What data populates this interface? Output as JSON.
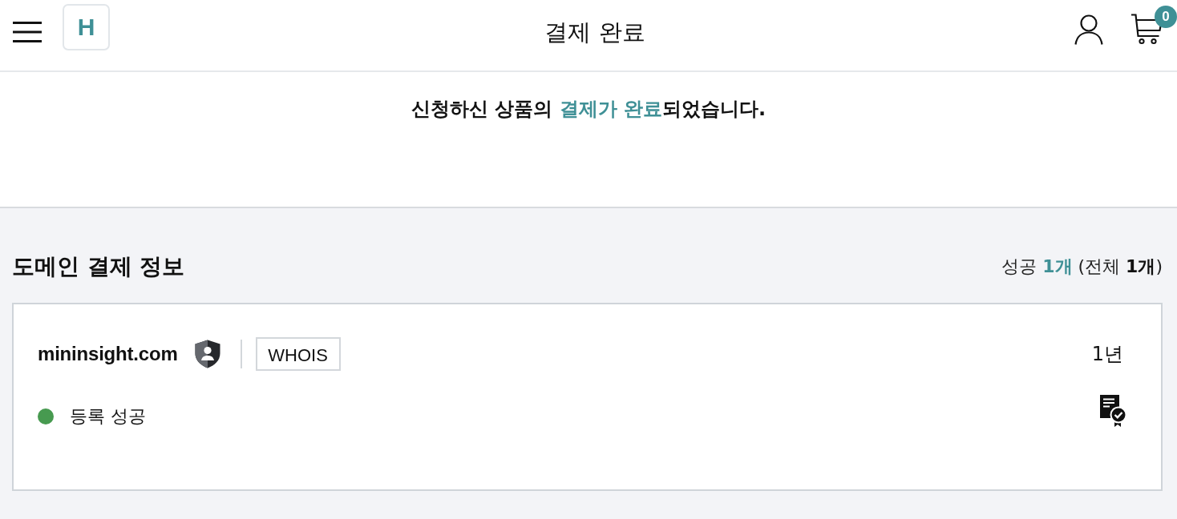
{
  "header": {
    "logo": "H",
    "title": "결제 완료",
    "cart_count": "0"
  },
  "notice": {
    "parts": [
      {
        "text": "신청하신 상품의 ",
        "highlight": false
      },
      {
        "text": "결제가 완료",
        "highlight": true
      },
      {
        "text": "되었습니다.",
        "highlight": false
      }
    ]
  },
  "section": {
    "title": "도메인 결제 정보",
    "summary": [
      {
        "text": "성공 ",
        "kind": "plain"
      },
      {
        "text": "1개",
        "kind": "accent"
      },
      {
        "text": " (전체 ",
        "kind": "plain"
      },
      {
        "text": "1개",
        "kind": "bold"
      },
      {
        "text": ")",
        "kind": "plain"
      }
    ]
  },
  "domains": [
    {
      "name": "mininsight.com",
      "privacy_protected": true,
      "whois_button": "WHOIS",
      "period": "1년",
      "status": {
        "label": "등록 성공",
        "color": "#479a50"
      }
    }
  ]
}
